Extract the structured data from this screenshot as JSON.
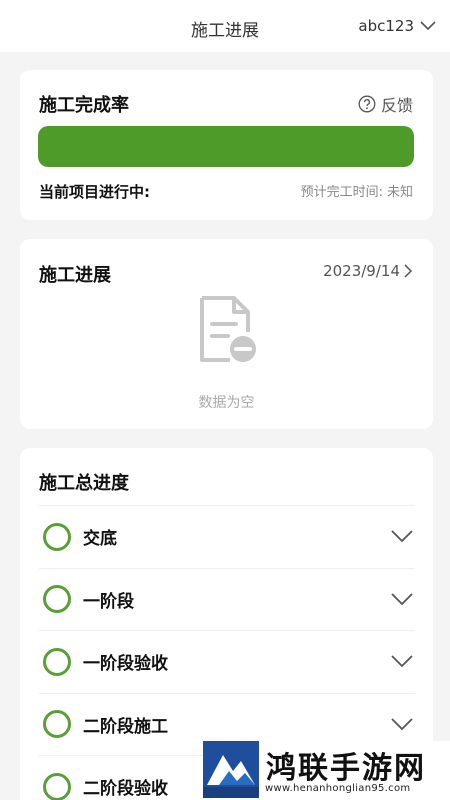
{
  "header": {
    "title": "施工进展",
    "account": "abc123"
  },
  "completion_card": {
    "title": "施工完成率",
    "feedback_label": "反馈",
    "progress_fraction": 1.0,
    "status_text": "当前项目进行中:",
    "eta_label": "预计完工时间:",
    "eta_value": "未知"
  },
  "progress_card": {
    "title": "施工进展",
    "date": "2023/9/14",
    "empty_text": "数据为空"
  },
  "stages_card": {
    "title": "施工总进度",
    "stages": [
      {
        "label": "交底"
      },
      {
        "label": "一阶段"
      },
      {
        "label": "一阶段验收"
      },
      {
        "label": "二阶段施工"
      },
      {
        "label": "二阶段验收"
      }
    ]
  },
  "watermark": {
    "name": "鸿联手游网",
    "url": "www.henanhonglian95.com"
  },
  "colors": {
    "accent_green": "#4f9b2a",
    "circle_green": "#5b9e37",
    "background": "#f4f4f4"
  },
  "icons": [
    "chevron-down-icon",
    "help-circle-icon",
    "chevron-right-icon",
    "empty-document-icon"
  ]
}
